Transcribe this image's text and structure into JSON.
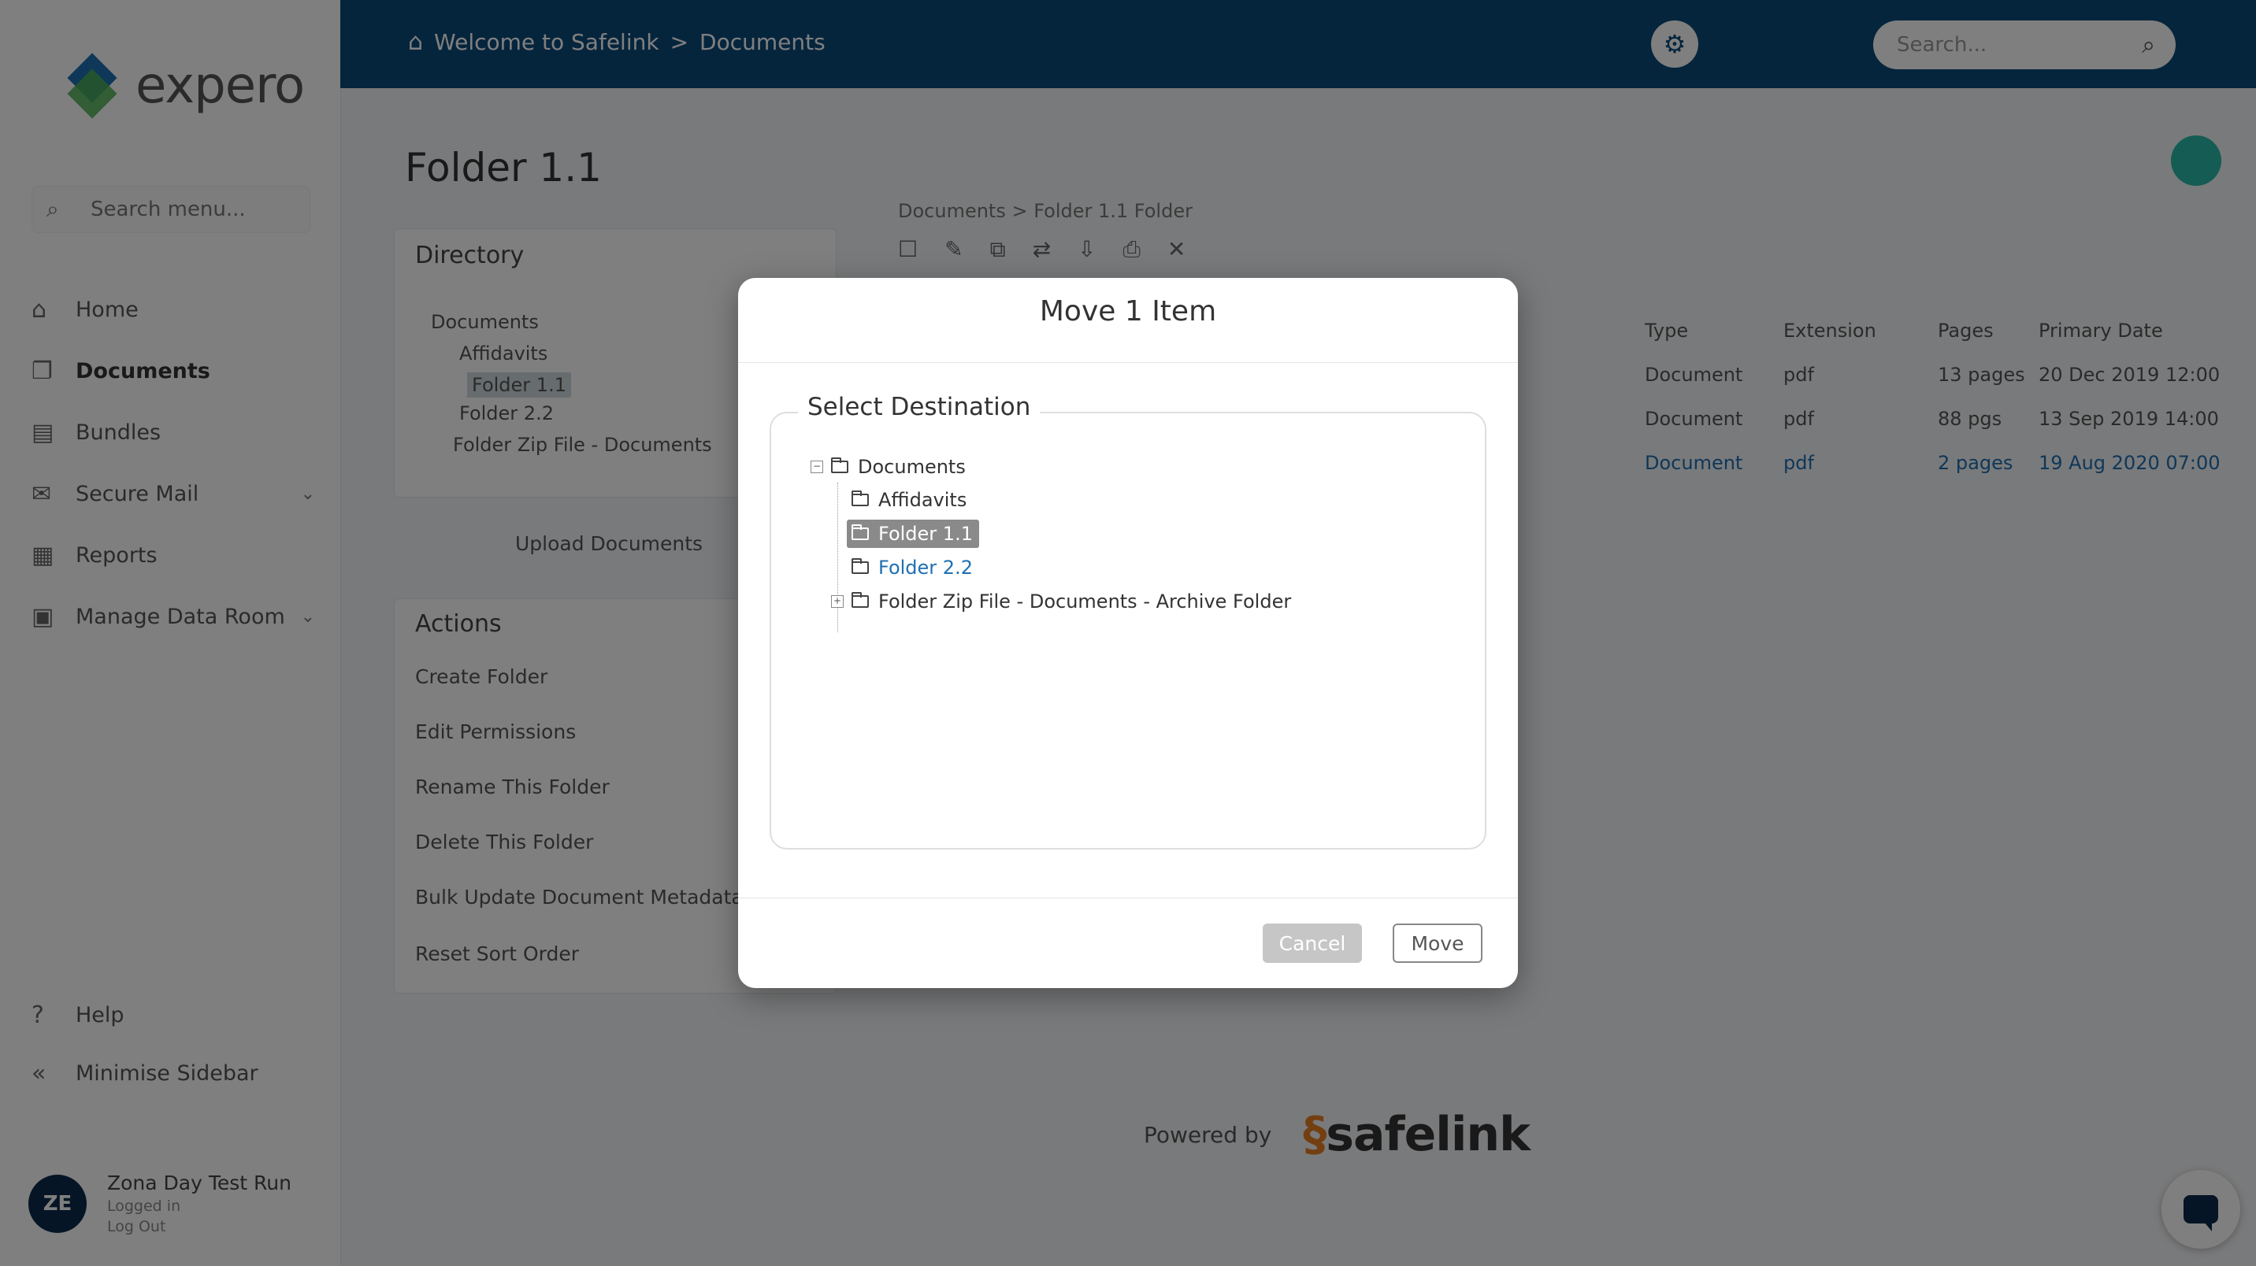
{
  "sidebar": {
    "logo_text": "expero",
    "search_placeholder": "Search menu...",
    "items": [
      {
        "label": "Home",
        "icon": "home-icon"
      },
      {
        "label": "Documents",
        "icon": "documents-icon"
      },
      {
        "label": "Bundles",
        "icon": "bundles-icon"
      },
      {
        "label": "Secure Mail",
        "icon": "mail-icon"
      },
      {
        "label": "Reports",
        "icon": "reports-icon"
      },
      {
        "label": "Manage Data Room",
        "icon": "data-room-icon"
      }
    ],
    "help": "Help",
    "minimise": "Minimise Sidebar",
    "user": {
      "initials": "ZE",
      "name": "Zona Day Test Run",
      "line2": "Logged in",
      "logout": "Log Out"
    }
  },
  "topbar": {
    "breadcrumb_root": "Welcome to Safelink",
    "breadcrumb_sep": ">",
    "breadcrumb_current": "Documents",
    "search_placeholder": "Search..."
  },
  "page": {
    "title": "Folder 1.1",
    "directory_title": "Directory",
    "tree": [
      "Documents",
      "Affidavits",
      "Folder 1.1",
      "Folder 2.2",
      "Folder Zip File - Documents"
    ],
    "upload_label": "Upload Documents",
    "actions_title": "Actions",
    "actions": [
      "Create Folder",
      "Edit Permissions",
      "Rename This Folder",
      "Delete This Folder",
      "Bulk Update Document Metadata",
      "Reset Sort Order"
    ],
    "doc_path": "Documents > Folder 1.1 Folder",
    "table_headers": [
      "Type",
      "Extension",
      "Pages",
      "Primary Date"
    ],
    "rows": [
      [
        "Document",
        "pdf",
        "13 pages",
        "20 Dec 2019 12:00"
      ],
      [
        "Document",
        "pdf",
        "88 pgs",
        "13 Sep 2019 14:00"
      ],
      [
        "Document",
        "pdf",
        "2 pages",
        "19 Aug 2020 07:00"
      ]
    ],
    "powered_by": "Powered by",
    "powered_brand": "safelink"
  },
  "modal": {
    "title": "Move 1 Item",
    "legend": "Select Destination",
    "tree": {
      "root": "Documents",
      "children": [
        "Affidavits",
        "Folder 1.1",
        "Folder 2.2",
        "Folder Zip File - Documents - Archive Folder"
      ]
    },
    "cancel_label": "Cancel",
    "move_label": "Move"
  }
}
